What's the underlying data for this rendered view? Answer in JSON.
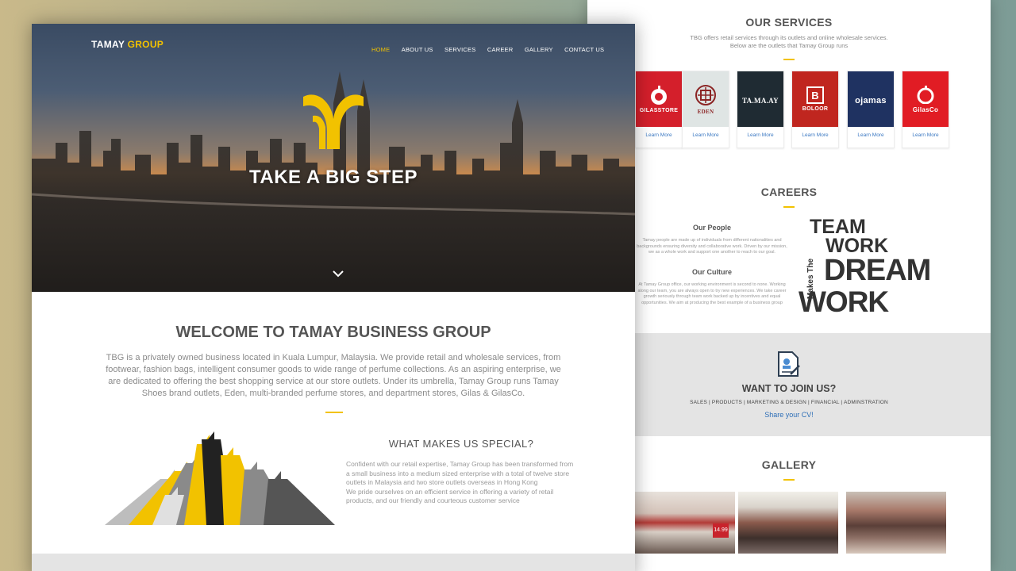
{
  "brand": {
    "word1": "TAMAY",
    "word2": " GROUP"
  },
  "nav": [
    "HOME",
    "ABOUT US",
    "SERVICES",
    "CAREER",
    "GALLERY",
    "CONTACT US"
  ],
  "hero": {
    "title": "TAKE A BIG STEP"
  },
  "welcome": {
    "title": "WELCOME TO TAMAY BUSINESS GROUP",
    "text": "TBG is a privately owned business located in Kuala Lumpur, Malaysia. We provide retail and wholesale services, from footwear, fashion bags, intelligent consumer goods to wide range of perfume collections. As an aspiring enterprise, we are dedicated to offering the best shopping service at our store outlets. Under its umbrella, Tamay Group runs Tamay Shoes brand outlets, Eden, multi-branded perfume stores, and department stores, Gilas & GilasCo."
  },
  "special": {
    "title": "WHAT MAKES US SPECIAL?",
    "p1": "Confident with our retail expertise, Tamay Group has been transformed from a small business into a medium sized enterprise with a total of twelve store outlets in Malaysia and two store outlets overseas in Hong Kong",
    "p2": "We pride ourselves on an efficient service in offering a variety of retail products, and our friendly and courteous customer service"
  },
  "services": {
    "title": "OUR SERVICES",
    "sub1": "TBG offers retail services through its outlets and online wholesale services.",
    "sub2": "Below are the outlets that Tamay Group runs",
    "outlets": [
      {
        "name": "GILASSTORE",
        "bg": "#d41f2b",
        "fg": "#ffffff",
        "link": "Learn More"
      },
      {
        "name": "EDEN",
        "bg": "#dfe5e4",
        "fg": "#8b2525",
        "link": "Learn More"
      },
      {
        "name": "TA.MA.AY",
        "bg": "#1f2b33",
        "fg": "#ffffff",
        "link": "Learn More"
      },
      {
        "name": "BOLOOR",
        "bg": "#c0261f",
        "fg": "#ffffff",
        "link": "Learn More"
      },
      {
        "name": "ojamas",
        "bg": "#1f3261",
        "fg": "#ffffff",
        "link": "Learn More"
      },
      {
        "name": "GilasCo",
        "bg": "#e11c24",
        "fg": "#ffffff",
        "link": "Learn More"
      }
    ]
  },
  "careers": {
    "title": "CAREERS",
    "people_title": "Our People",
    "people_text": "Tamay people are made up of individuals from different nationalities and backgrounds ensuring diversity and collaborative work. Driven by our mission, we as a whole work and support one another to reach to our goal.",
    "culture_title": "Our Culture",
    "culture_text": "At Tamay Group office, our working environment is second to none. Working along our team, you are always open to try new experiences. We take career growth seriously through team work backed up by incentives and equal opportunities. We aim at producing the best example of a business group",
    "poster": {
      "team": "TEAM",
      "work1": "WORK",
      "makes": "Makes The",
      "dream": "DREAM",
      "work2": "WORK"
    }
  },
  "join": {
    "title": "WANT TO JOIN US?",
    "depts": "SALES | PRODUCTS | MARKETING & DESIGN | FINANCIAL | ADMINSTRATION",
    "cta": "Share your CV!"
  },
  "gallery": {
    "title": "GALLERY",
    "price_tag": "14.99"
  },
  "colors": {
    "accent": "#f2c200",
    "link": "#3a78c2"
  }
}
